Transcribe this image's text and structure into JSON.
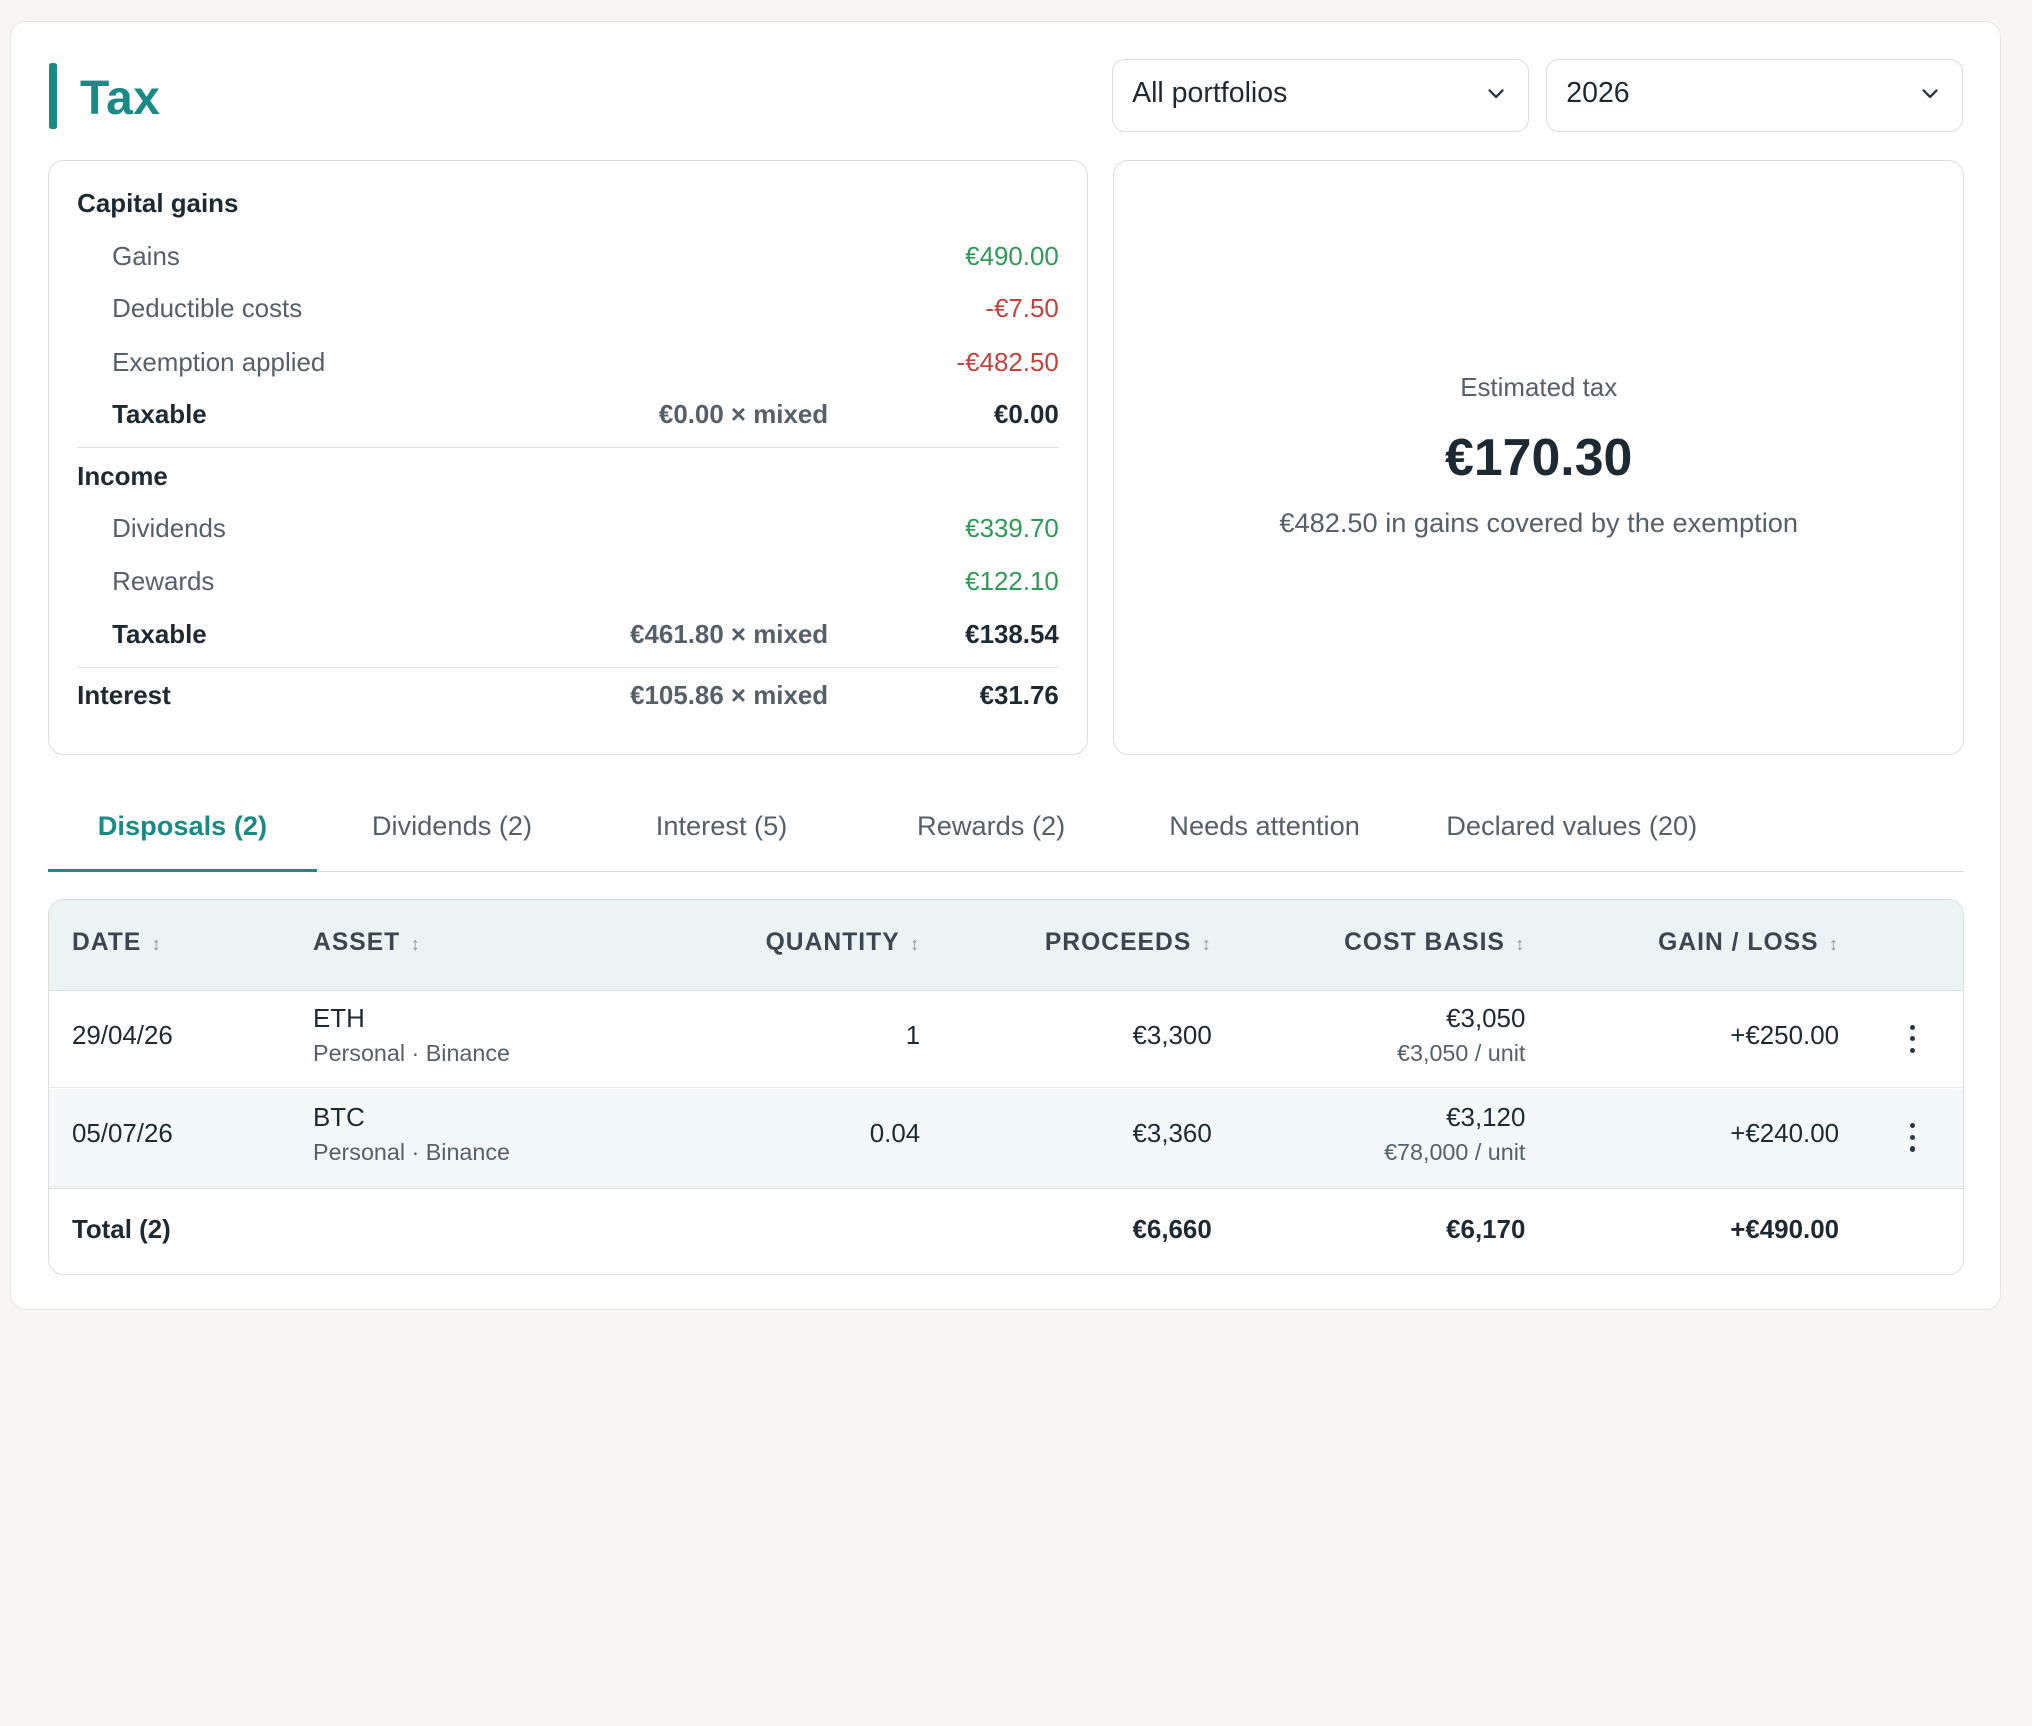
{
  "header": {
    "title": "Tax",
    "portfolio_select": "All portfolios",
    "year_select": "2026"
  },
  "capital_gains": {
    "heading": "Capital gains",
    "gains_label": "Gains",
    "gains_value": "€490.00",
    "deductible_label": "Deductible costs",
    "deductible_value": "-€7.50",
    "exemption_label": "Exemption applied",
    "exemption_value": "-€482.50",
    "taxable_label": "Taxable",
    "taxable_mid": "€0.00 × mixed",
    "taxable_value": "€0.00"
  },
  "income": {
    "heading": "Income",
    "dividends_label": "Dividends",
    "dividends_value": "€339.70",
    "rewards_label": "Rewards",
    "rewards_value": "€122.10",
    "taxable_label": "Taxable",
    "taxable_mid": "€461.80 × mixed",
    "taxable_value": "€138.54"
  },
  "interest": {
    "label": "Interest",
    "mid": "€105.86 × mixed",
    "value": "€31.76"
  },
  "estimate": {
    "label": "Estimated tax",
    "value": "€170.30",
    "note": "€482.50 in gains covered by the exemption"
  },
  "tabs": [
    {
      "label": "Disposals (2)",
      "active": true
    },
    {
      "label": "Dividends (2)"
    },
    {
      "label": "Interest (5)"
    },
    {
      "label": "Rewards (2)"
    },
    {
      "label": "Needs attention"
    },
    {
      "label": "Declared values (20)"
    }
  ],
  "table": {
    "columns": [
      "DATE",
      "ASSET",
      "QUANTITY",
      "PROCEEDS",
      "COST BASIS",
      "GAIN / LOSS"
    ],
    "sort_glyph": "↕",
    "rows": [
      {
        "date": "29/04/26",
        "asset": "ETH",
        "asset_sub": "Personal · Binance",
        "quantity": "1",
        "proceeds": "€3,300",
        "cost_basis": "€3,050",
        "cost_unit": "€3,050 / unit",
        "gain": "+€250.00"
      },
      {
        "date": "05/07/26",
        "asset": "BTC",
        "asset_sub": "Personal · Binance",
        "quantity": "0.04",
        "proceeds": "€3,360",
        "cost_basis": "€3,120",
        "cost_unit": "€78,000 / unit",
        "gain": "+€240.00"
      }
    ],
    "total": {
      "label": "Total (2)",
      "proceeds": "€6,660",
      "cost_basis": "€6,170",
      "gain": "+€490.00"
    }
  },
  "colors": {
    "accent": "#1a8a86",
    "positive": "#2e9a55",
    "negative": "#c0443a"
  }
}
